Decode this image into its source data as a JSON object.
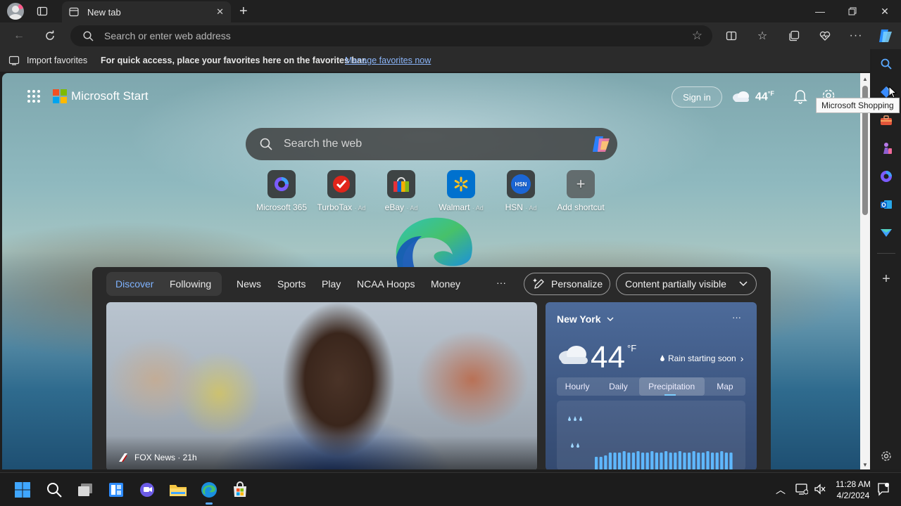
{
  "browser": {
    "tab_title": "New tab",
    "address_placeholder": "Search or enter web address"
  },
  "favorites_bar": {
    "import_label": "Import favorites",
    "message": "For quick access, place your favorites here on the favorites bar.",
    "manage_link": "Manage favorites now"
  },
  "start_page": {
    "brand": "Microsoft Start",
    "sign_in": "Sign in",
    "header_temp": "44",
    "header_temp_unit": "°F",
    "search_placeholder": "Search the web",
    "shortcuts": [
      {
        "label": "Microsoft 365",
        "ad": ""
      },
      {
        "label": "TurboTax",
        "ad": "· Ad"
      },
      {
        "label": "eBay",
        "ad": "· Ad"
      },
      {
        "label": "Walmart",
        "ad": "· Ad"
      },
      {
        "label": "HSN",
        "ad": "· Ad"
      },
      {
        "label": "Add shortcut",
        "ad": ""
      }
    ],
    "hsn_logo_text": "HSN"
  },
  "feed": {
    "tabs": [
      "Discover",
      "Following",
      "News",
      "Sports",
      "Play",
      "NCAA Hoops",
      "Money"
    ],
    "more": "···",
    "personalize": "Personalize",
    "content_visibility": "Content partially visible",
    "hero_source": "FOX News · 21h"
  },
  "weather": {
    "location": "New York",
    "temp": "44",
    "unit": "°F",
    "alert": "Rain starting soon",
    "tabs": [
      "Hourly",
      "Daily",
      "Precipitation",
      "Map"
    ],
    "active_tab": "Precipitation",
    "more": "···"
  },
  "tooltip": "Microsoft Shopping",
  "clock": {
    "time": "11:28 AM",
    "date": "4/2/2024"
  },
  "colors": {
    "accent_link": "#8ab4f8",
    "discover_active": "#7fb3ff",
    "edge_blue": "#1a8fe0",
    "edge_green": "#47c16a"
  }
}
